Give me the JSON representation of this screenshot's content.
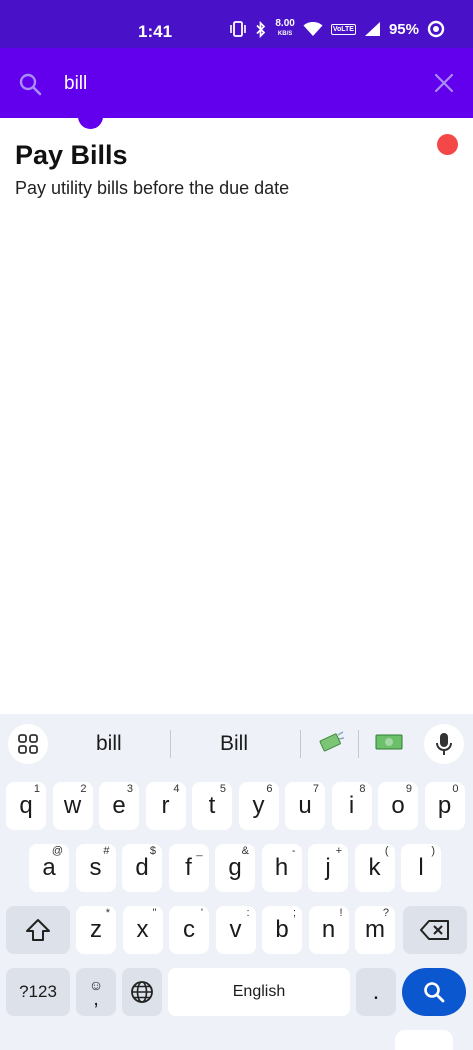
{
  "status_bar": {
    "time": "1:41",
    "net_speed_value": "8.00",
    "net_speed_unit": "KB/S",
    "volte_top": "Vo",
    "volte_bottom": "LTE",
    "battery": "95%"
  },
  "search": {
    "query": "bill"
  },
  "results": [
    {
      "title": "Pay Bills",
      "description": "Pay utility bills before the due date",
      "dot_color": "#f44848"
    }
  ],
  "keyboard": {
    "suggestions": [
      "bill",
      "Bill"
    ],
    "row1": [
      {
        "k": "q",
        "h": "1"
      },
      {
        "k": "w",
        "h": "2"
      },
      {
        "k": "e",
        "h": "3"
      },
      {
        "k": "r",
        "h": "4"
      },
      {
        "k": "t",
        "h": "5"
      },
      {
        "k": "y",
        "h": "6"
      },
      {
        "k": "u",
        "h": "7"
      },
      {
        "k": "i",
        "h": "8"
      },
      {
        "k": "o",
        "h": "9"
      },
      {
        "k": "p",
        "h": "0"
      }
    ],
    "row2": [
      {
        "k": "a",
        "h": "@"
      },
      {
        "k": "s",
        "h": "#"
      },
      {
        "k": "d",
        "h": "$"
      },
      {
        "k": "f",
        "h": "_"
      },
      {
        "k": "g",
        "h": "&"
      },
      {
        "k": "h",
        "h": "-"
      },
      {
        "k": "j",
        "h": "+"
      },
      {
        "k": "k",
        "h": "("
      },
      {
        "k": "l",
        "h": ")"
      }
    ],
    "row3": [
      {
        "k": "z",
        "h": "*"
      },
      {
        "k": "x",
        "h": "\""
      },
      {
        "k": "c",
        "h": "'"
      },
      {
        "k": "v",
        "h": ":"
      },
      {
        "k": "b",
        "h": ";"
      },
      {
        "k": "n",
        "h": "!"
      },
      {
        "k": "m",
        "h": "?"
      }
    ],
    "symbols_label": "?123",
    "emoji_key_top": "☺",
    "emoji_key_bottom": ",",
    "space_label": "English",
    "period_label": ".",
    "accent_color": "#0b57d0"
  },
  "colors": {
    "status_bar": "#4a12c8",
    "app_bar": "#6200ee"
  }
}
